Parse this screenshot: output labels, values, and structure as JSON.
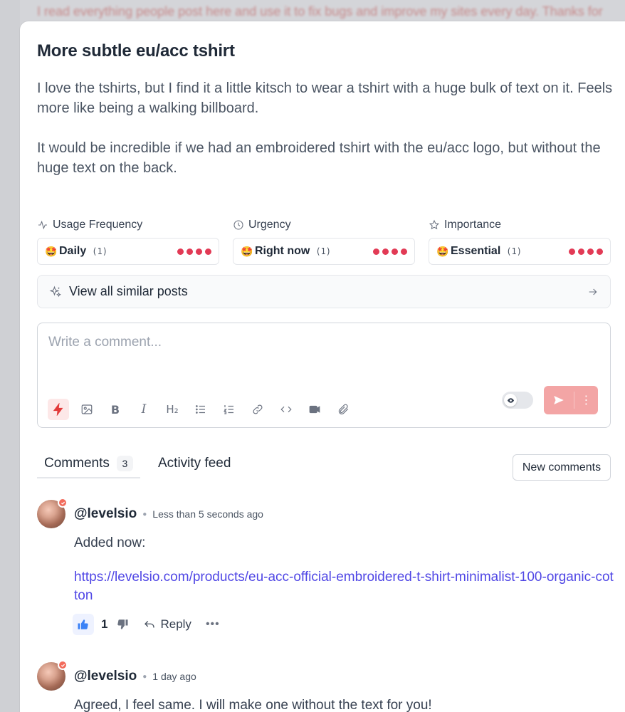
{
  "backdrop": {
    "text": "I read everything people post here and use it to fix bugs and improve my sites every day. Thanks for"
  },
  "post": {
    "title": "More subtle eu/acc tshirt",
    "paragraphs": [
      "I love the tshirts, but I find it a little kitsch to wear a tshirt with a huge bulk of text on it. Feels more like being a walking billboard.",
      "It would be incredible if we had an embroidered tshirt with the eu/acc logo, but without the huge text on the back."
    ]
  },
  "metrics": {
    "usage": {
      "label": "Usage Frequency",
      "icon": "activity-icon",
      "emoji": "🤩",
      "value": "Daily",
      "count": "(1)"
    },
    "urgency": {
      "label": "Urgency",
      "icon": "clock-icon",
      "emoji": "🤩",
      "value": "Right now",
      "count": "(1)"
    },
    "importance": {
      "label": "Importance",
      "icon": "star-icon",
      "emoji": "🤩",
      "value": "Essential",
      "count": "(1)"
    },
    "dot_color": "#e23a55"
  },
  "similar": {
    "label": "View all similar posts",
    "icon": "sparkles-icon"
  },
  "composer": {
    "placeholder": "Write a comment...",
    "toolbar": [
      "bolt-icon",
      "image-icon",
      "bold-icon",
      "italic-icon",
      "heading2-icon",
      "bullet-list-icon",
      "numbered-list-icon",
      "link-icon",
      "code-icon",
      "video-icon",
      "attachment-icon"
    ],
    "accent": "#f3a5a5"
  },
  "tabs": {
    "comments_label": "Comments",
    "comments_count": "3",
    "feed_label": "Activity feed",
    "new_comments": "New comments"
  },
  "comments": [
    {
      "author": "@levelsio",
      "time": "Less than 5 seconds ago",
      "text": "Added now:",
      "link": "https://levelsio.com/products/eu-acc-official-embroidered-t-shirt-minimalist-100-organic-cotton",
      "likes": "1",
      "reply": "Reply",
      "more": "•••"
    },
    {
      "author": "@levelsio",
      "time": "1 day ago",
      "text": "Agreed, I feel same. I will make one without the text for you!"
    }
  ]
}
